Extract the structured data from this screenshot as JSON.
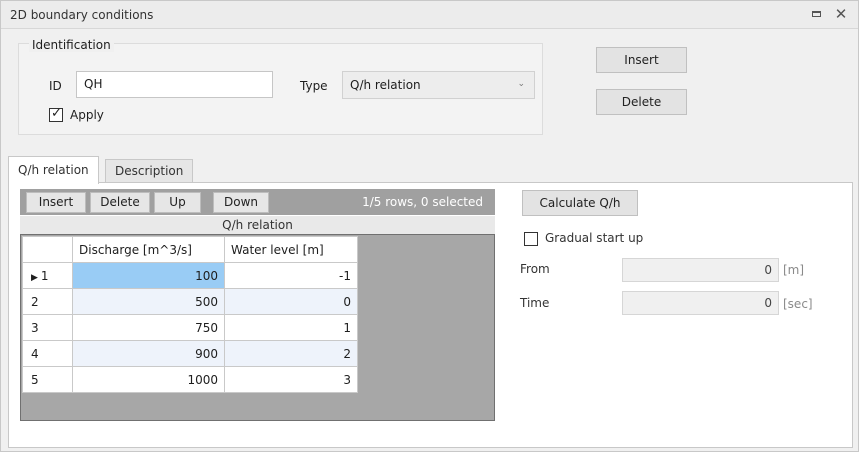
{
  "window": {
    "title": "2D boundary conditions",
    "restore_icon": "restore-icon",
    "close_symbol": "✕"
  },
  "identification": {
    "legend": "Identification",
    "id_label": "ID",
    "id_value": "QH",
    "type_label": "Type",
    "type_value": "Q/h relation",
    "apply_label": "Apply",
    "apply_checked": true
  },
  "side_buttons": {
    "insert": "Insert",
    "delete": "Delete"
  },
  "tabs": [
    {
      "label": "Q/h relation",
      "active": true
    },
    {
      "label": "Description",
      "active": false
    }
  ],
  "grid": {
    "toolbar": {
      "insert": "Insert",
      "delete": "Delete",
      "up": "Up",
      "down": "Down",
      "info": "1/5 rows, 0 selected"
    },
    "caption": "Q/h relation",
    "columns": [
      "Discharge [m^3/s]",
      "Water level [m]"
    ],
    "rows": [
      {
        "index": "1",
        "discharge": "100",
        "water_level": "-1",
        "current": true
      },
      {
        "index": "2",
        "discharge": "500",
        "water_level": "0",
        "current": false
      },
      {
        "index": "3",
        "discharge": "750",
        "water_level": "1",
        "current": false
      },
      {
        "index": "4",
        "discharge": "900",
        "water_level": "2",
        "current": false
      },
      {
        "index": "5",
        "discharge": "1000",
        "water_level": "3",
        "current": false
      }
    ]
  },
  "calc": {
    "button": "Calculate Q/h",
    "gradual_label": "Gradual start up",
    "gradual_checked": false,
    "from_label": "From",
    "from_value": "0",
    "from_unit": "[m]",
    "time_label": "Time",
    "time_value": "0",
    "time_unit": "[sec]"
  },
  "colors": {
    "selected_cell": "#99ccf5",
    "alt_row": "#eef3fb",
    "grid_background": "#a7a7a7"
  }
}
